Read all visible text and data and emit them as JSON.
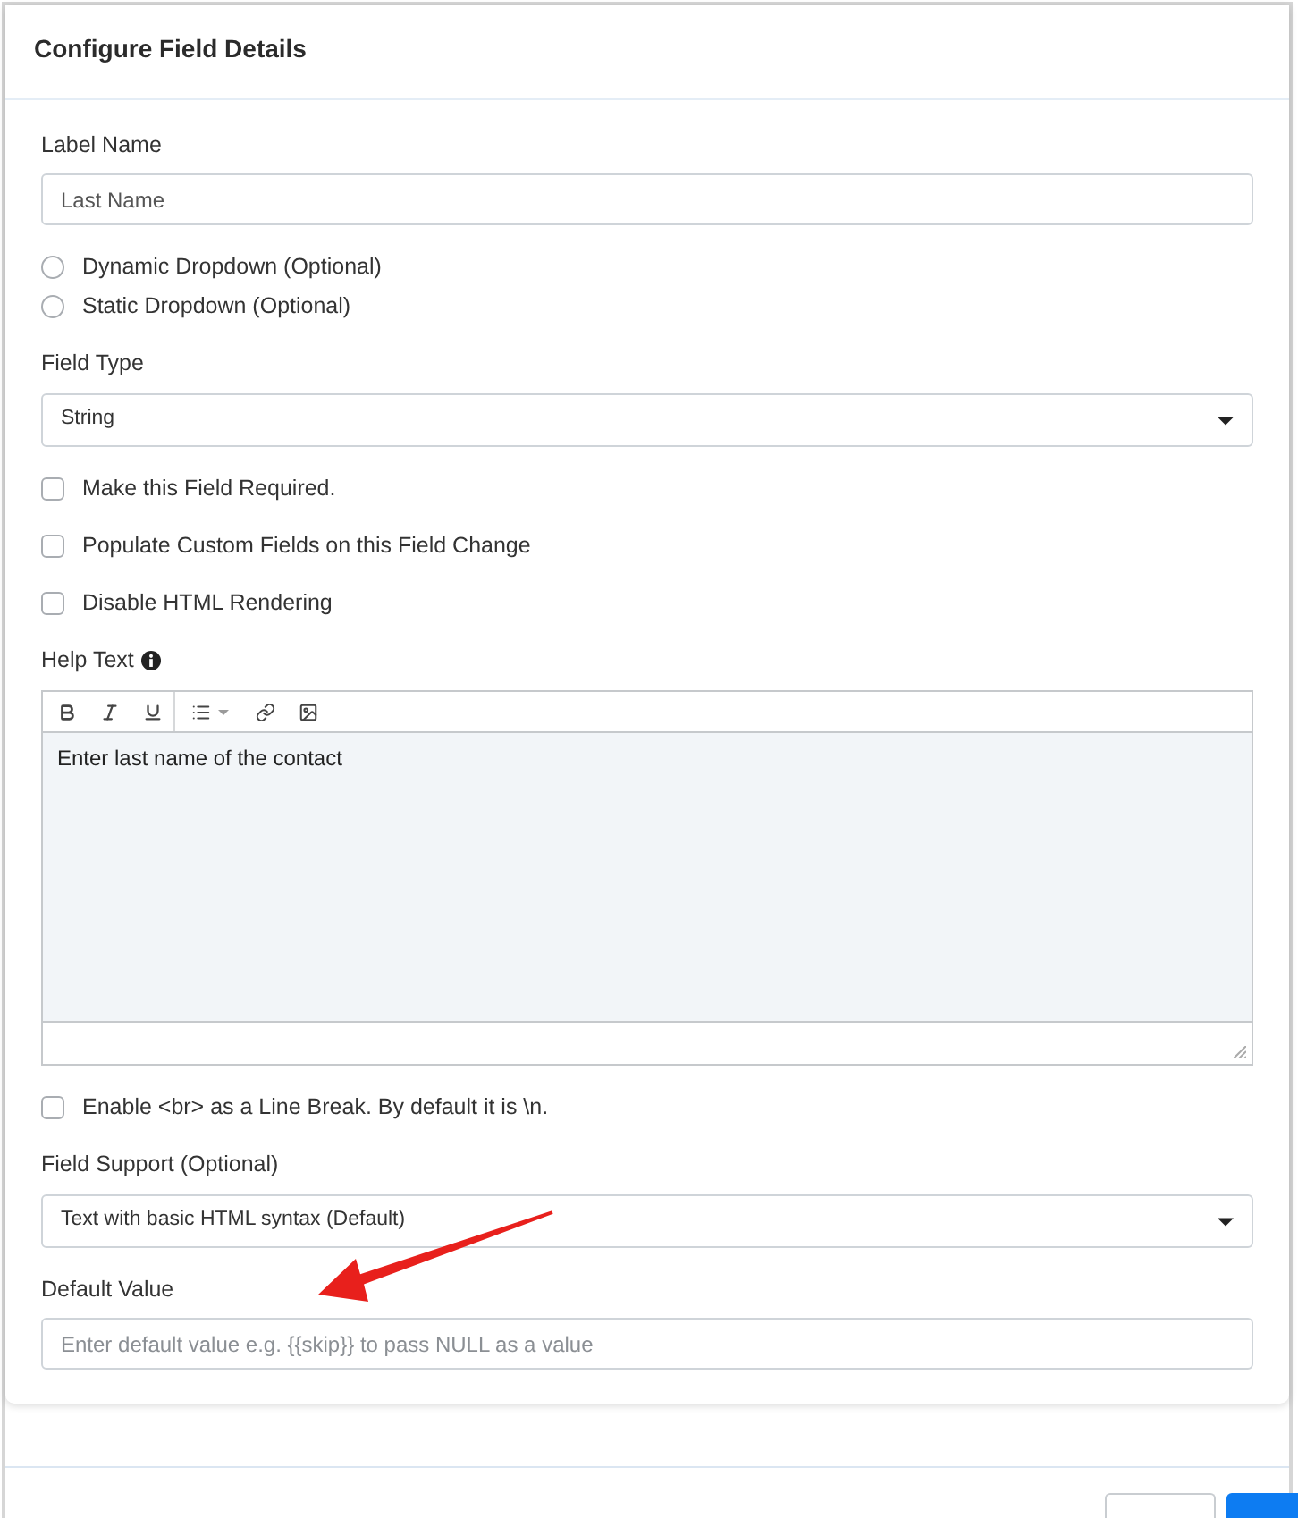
{
  "dialog": {
    "title": "Configure Field Details"
  },
  "fields": [
    {
      "kind": "text",
      "label": "Label Name",
      "value": "Last Name"
    },
    {
      "kind": "radio",
      "label": "Dynamic Dropdown (Optional)",
      "selected": false
    },
    {
      "kind": "radio",
      "label": "Static Dropdown (Optional)",
      "selected": false
    },
    {
      "kind": "select",
      "label": "Field Type",
      "value": "String"
    },
    {
      "kind": "checkbox",
      "label": "Make this Field Required.",
      "checked": false
    },
    {
      "kind": "checkbox",
      "label": "Populate Custom Fields on this Field Change",
      "checked": false
    },
    {
      "kind": "checkbox",
      "label": "Disable HTML Rendering",
      "checked": false
    },
    {
      "kind": "editor",
      "label": "Help Text",
      "value": "Enter last name of the contact"
    },
    {
      "kind": "checkbox",
      "label": "Enable <br> as a Line Break. By default it is \\n.",
      "checked": false
    },
    {
      "kind": "select",
      "label": "Field Support (Optional)",
      "value": "Text with basic HTML syntax (Default)"
    },
    {
      "kind": "text",
      "label": "Default Value",
      "placeholder": "Enter default value e.g. {{skip}} to pass NULL as a value"
    }
  ],
  "footer": {
    "buttons": [
      {
        "kind": "secondary"
      },
      {
        "kind": "primary"
      }
    ]
  }
}
